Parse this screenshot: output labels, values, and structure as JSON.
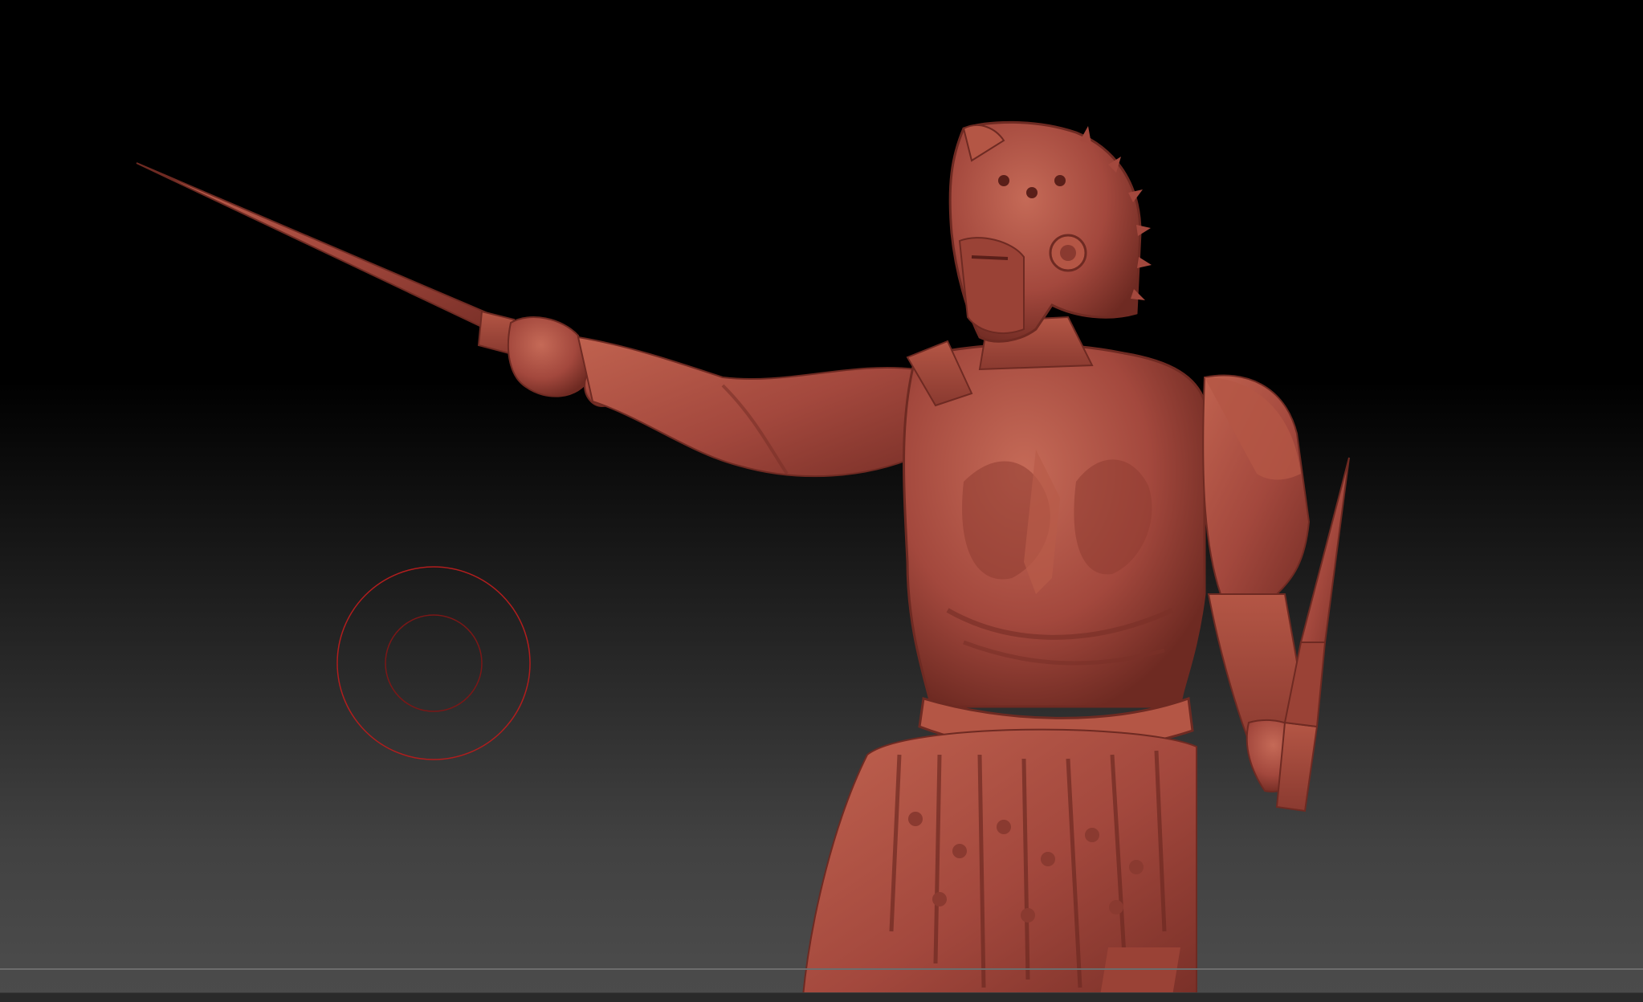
{
  "viewport": {
    "background_top_color": "#000000",
    "background_bottom_color": "#4b4b4b"
  },
  "model": {
    "material_color": "#a3483d",
    "shadow_color": "#6e2a22",
    "highlight_color": "#c9705f"
  },
  "brush_cursor": {
    "color": "#b01d1d"
  }
}
